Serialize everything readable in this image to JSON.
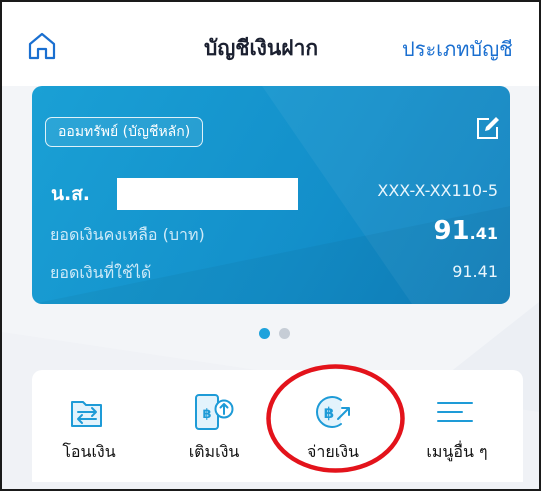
{
  "header": {
    "title": "บัญชีเงินฝาก",
    "account_type_link": "ประเภทบัญชี"
  },
  "account_card": {
    "badge": "ออมทรัพย์ (บัญชีหลัก)",
    "holder_name": "น.ส.",
    "account_number": "XXX-X-XX110-5",
    "balance_label": "ยอดเงินคงเหลือ (บาท)",
    "balance_integer": "91",
    "balance_decimal": ".41",
    "available_label": "ยอดเงินที่ใช้ได้",
    "available_value": "91.41"
  },
  "pager": {
    "total": 2,
    "active": 1
  },
  "menu": [
    {
      "label": "โอนเงิน",
      "icon": "transfer-icon"
    },
    {
      "label": "เติมเงิน",
      "icon": "topup-icon"
    },
    {
      "label": "จ่ายเงิน",
      "icon": "bill-payment-icon"
    },
    {
      "label": "เมนูอื่น ๆ",
      "icon": "more-menu-icon"
    }
  ],
  "colors": {
    "accent": "#1a6fd0",
    "card": "#1596cf",
    "highlight_ring": "#e3131b"
  }
}
